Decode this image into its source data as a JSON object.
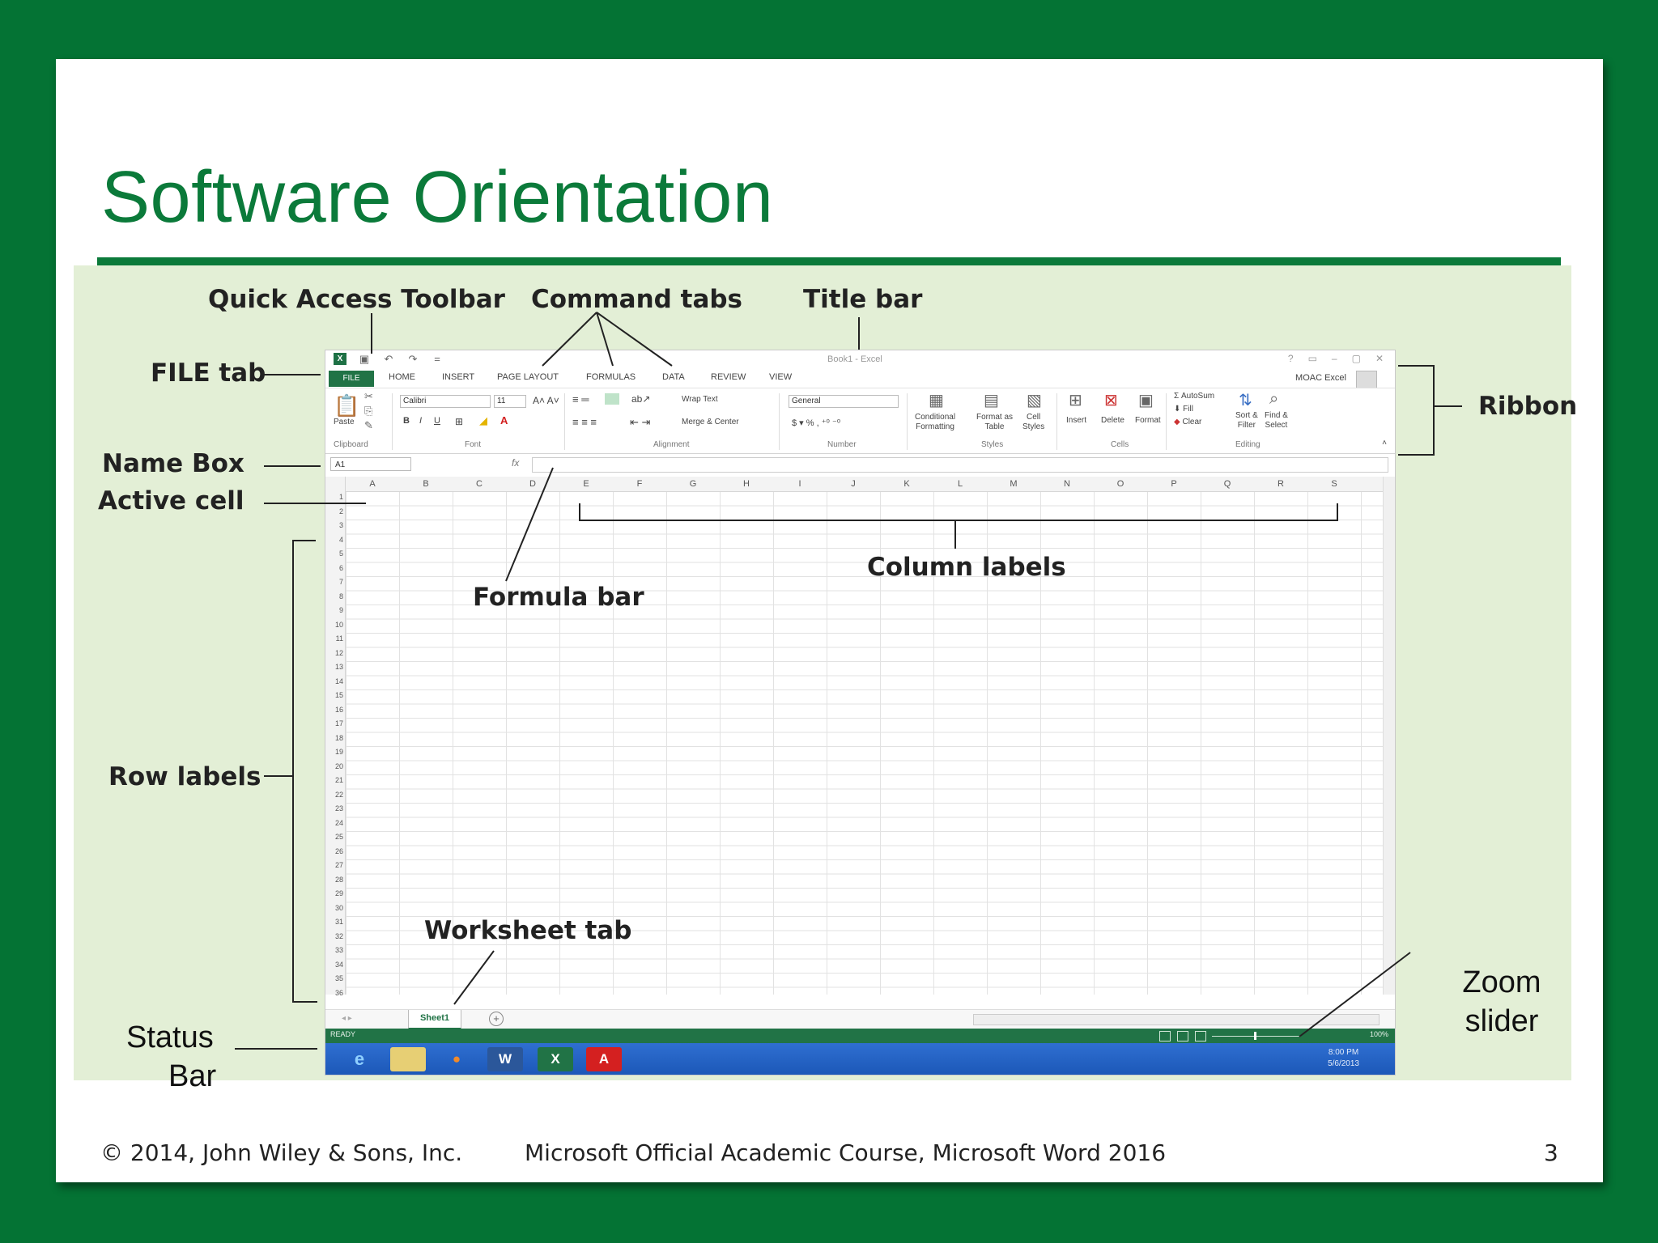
{
  "slide": {
    "title": "Software Orientation",
    "footer_left": "© 2014, John Wiley & Sons, Inc.",
    "footer_center": "Microsoft Official Academic Course, Microsoft Word 2016",
    "page_number": "3"
  },
  "callouts": {
    "quick_access_toolbar": "Quick Access Toolbar",
    "command_tabs": "Command tabs",
    "title_bar": "Title bar",
    "file_tab": "FILE tab",
    "ribbon": "Ribbon",
    "name_box": "Name Box",
    "active_cell": "Active cell",
    "column_labels": "Column labels",
    "formula_bar": "Formula bar",
    "row_labels": "Row labels",
    "worksheet_tab": "Worksheet tab",
    "zoom_slider_line1": "Zoom",
    "zoom_slider_line2": "slider",
    "status_bar_line1": "Status",
    "status_bar_line2": "Bar"
  },
  "excel": {
    "window_title": "Book1 - Excel",
    "window_controls": [
      "?",
      "▭",
      "–",
      "▢",
      "✕"
    ],
    "quick_access": [
      "excel-logo-icon",
      "save-icon",
      "undo-icon",
      "redo-icon",
      "customize-icon"
    ],
    "tabs": [
      {
        "label": "FILE"
      },
      {
        "label": "HOME"
      },
      {
        "label": "INSERT"
      },
      {
        "label": "PAGE LAYOUT"
      },
      {
        "label": "FORMULAS"
      },
      {
        "label": "DATA"
      },
      {
        "label": "REVIEW"
      },
      {
        "label": "VIEW"
      }
    ],
    "account": "MOAC Excel",
    "ribbon": {
      "groups": [
        "Clipboard",
        "Font",
        "Alignment",
        "Number",
        "Styles",
        "Cells",
        "Editing"
      ],
      "paste": "Paste",
      "font_name": "Calibri",
      "font_size": "11",
      "wrap_text": "Wrap Text",
      "merge_center": "Merge & Center",
      "number_format": "General",
      "conditional_formatting": [
        "Conditional",
        "Formatting"
      ],
      "format_as_table": [
        "Format as",
        "Table"
      ],
      "cell_styles": [
        "Cell",
        "Styles"
      ],
      "insert": "Insert",
      "delete": "Delete",
      "format": "Format",
      "autosum": "AutoSum",
      "fill": "Fill",
      "clear": "Clear",
      "sort_filter": [
        "Sort &",
        "Filter"
      ],
      "find_select": [
        "Find &",
        "Select"
      ]
    },
    "name_box": "A1",
    "fx_label": "fx",
    "columns": [
      "A",
      "B",
      "C",
      "D",
      "E",
      "F",
      "G",
      "H",
      "I",
      "J",
      "K",
      "L",
      "M",
      "N",
      "O",
      "P",
      "Q",
      "R",
      "S"
    ],
    "rows": [
      "1",
      "2",
      "3",
      "4",
      "5",
      "6",
      "7",
      "8",
      "9",
      "10",
      "11",
      "12",
      "13",
      "14",
      "15",
      "16",
      "17",
      "18",
      "19",
      "20",
      "21",
      "22",
      "23",
      "24",
      "25",
      "26",
      "27",
      "28",
      "29",
      "30",
      "31",
      "32",
      "33",
      "34",
      "35",
      "36"
    ],
    "sheet_tab": "Sheet1",
    "add_sheet": "+",
    "status": "READY",
    "zoom": "100%",
    "clock_time": "8:00 PM",
    "clock_date": "5/6/2013",
    "taskbar_apps": [
      "internet-explorer-icon",
      "file-explorer-icon",
      "media-player-icon",
      "word-icon",
      "excel-icon",
      "acrobat-icon"
    ]
  },
  "colors": {
    "background": "#047334",
    "title_green": "#0b7a3a",
    "panel": "#e3efd6",
    "excel_green": "#217346",
    "taskbar_blue": "#2463c6"
  }
}
